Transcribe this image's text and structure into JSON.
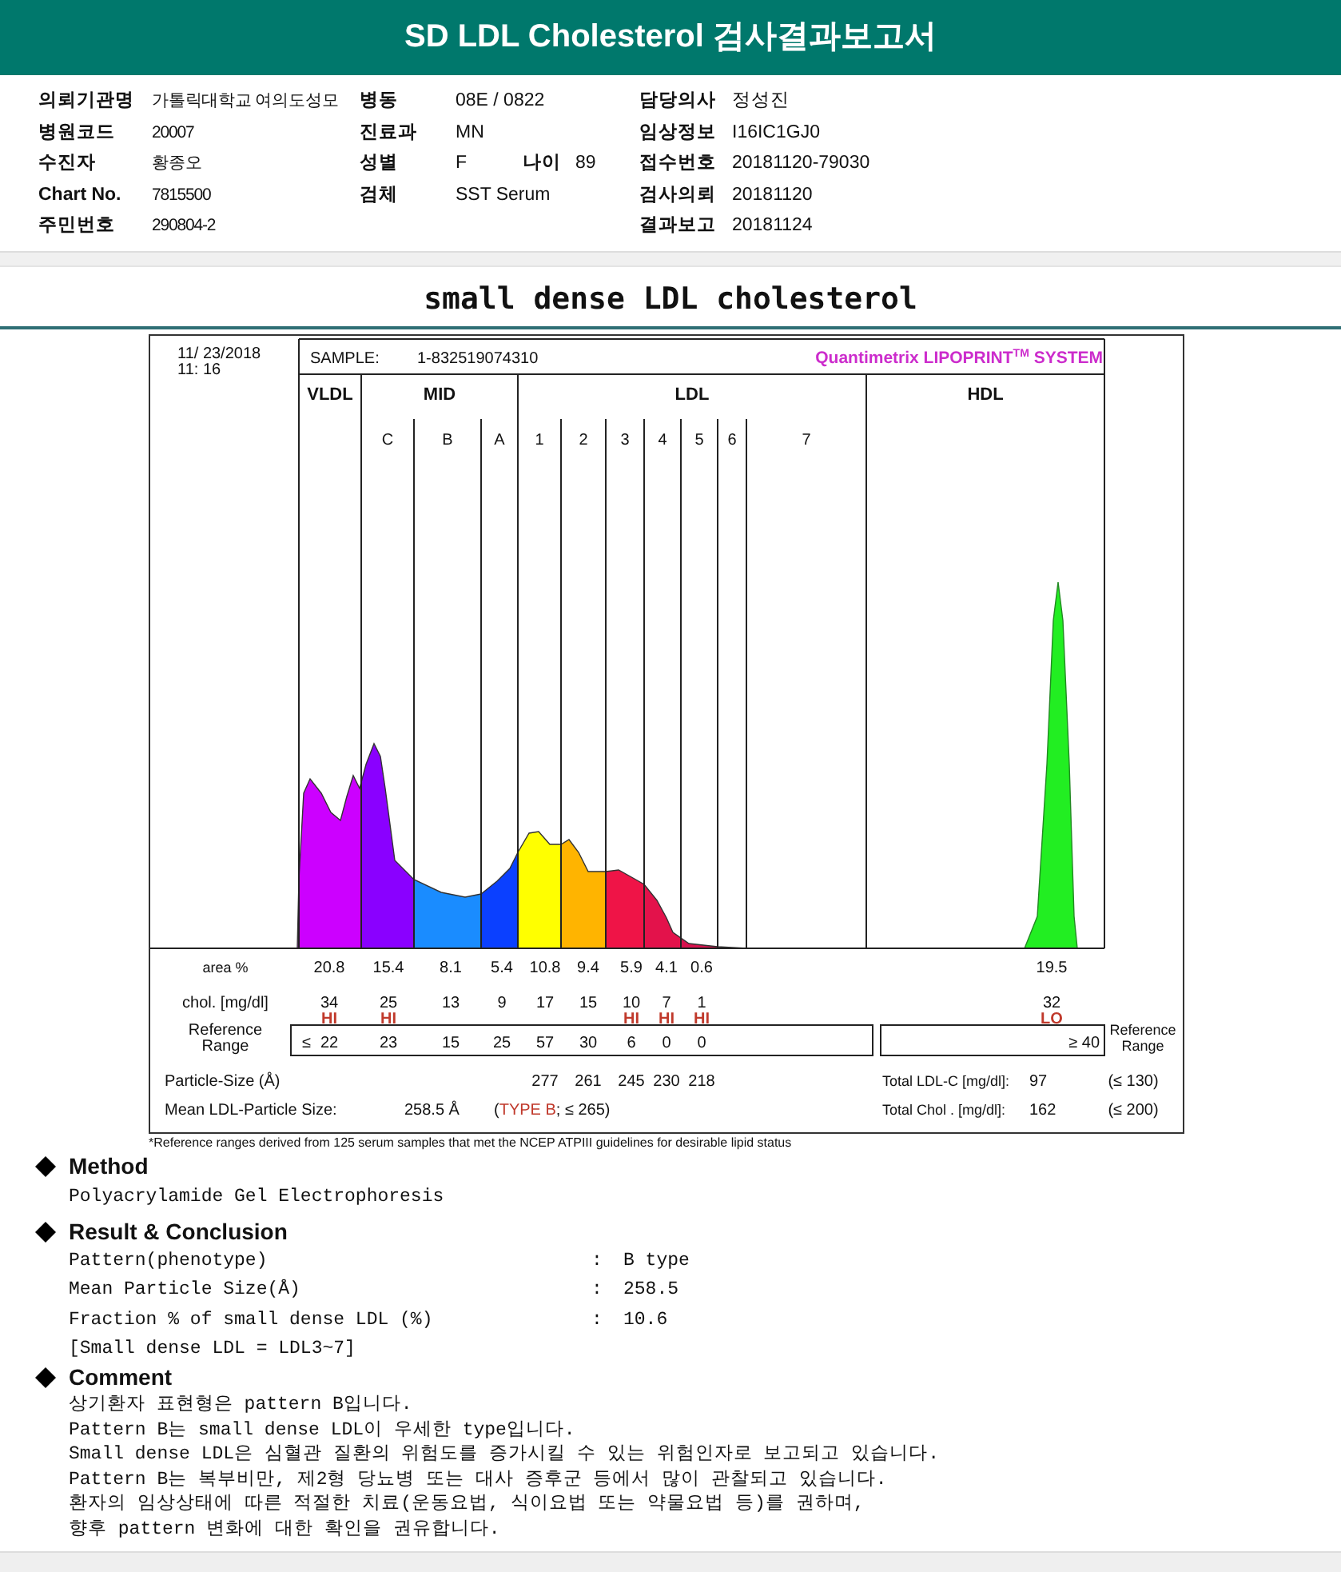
{
  "header": {
    "title": "SD LDL Cholesterol 검사결과보고서"
  },
  "info_rows": [
    {
      "left": {
        "label": "의뢰기관명",
        "value": "가톨릭대학교 여의도성모"
      },
      "middle": {
        "label": "병동",
        "value": "08E / 0822"
      },
      "right": {
        "label": "담당의사",
        "value": "정성진"
      }
    },
    {
      "left": {
        "label": "병원코드",
        "value": "20007"
      },
      "middle": {
        "label": "진료과",
        "value": "MN"
      },
      "right": {
        "label": "임상정보",
        "value": "I16IC1GJ0"
      }
    },
    {
      "left": {
        "label": "수진자",
        "value": "황종오"
      },
      "middle": {
        "label": "성별",
        "value": "F",
        "extra_label": "나이",
        "extra_value": "89"
      },
      "right": {
        "label": "접수번호",
        "value": "20181120-79030"
      }
    },
    {
      "left": {
        "label": "Chart No.",
        "value": "7815500"
      },
      "middle": {
        "label": "검체",
        "value": "SST Serum"
      },
      "right": {
        "label": "검사의뢰",
        "value": "20181120"
      }
    },
    {
      "left": {
        "label": "주민번호",
        "value": "290804-2"
      },
      "right": {
        "label": "결과보고",
        "value": "20181124"
      }
    }
  ],
  "section_title": "small dense LDL cholesterol",
  "electrophoresis": {
    "date": "11/ 23/2018",
    "time": "11: 16",
    "sample_label": "SAMPLE:",
    "sample_id": "1-832519074310",
    "system_parts": [
      {
        "text": "Quantimetrix LIPOPRINT",
        "kind": "plain"
      },
      {
        "text": "TM",
        "kind": "sup"
      },
      {
        "text": " SYSTEM",
        "kind": "plain"
      }
    ],
    "groups": [
      "VLDL",
      "MID",
      "LDL",
      "HDL"
    ],
    "subfractions": [
      "C",
      "B",
      "A",
      "1",
      "2",
      "3",
      "4",
      "5",
      "6",
      "7"
    ],
    "area_label": "area %",
    "chol_label": "chol. [mg/dl]",
    "reference_label": "Reference Range",
    "reference_label_right": "Reference Range",
    "ref_prefix": "≤",
    "columns": [
      {
        "area": "20.8",
        "chol": "34",
        "flag": "HI",
        "ref": "22"
      },
      {
        "area": "15.4",
        "chol": "25",
        "flag": "HI",
        "ref": "23"
      },
      {
        "area": "8.1",
        "chol": "13",
        "ref": "15"
      },
      {
        "area": "5.4",
        "chol": "9",
        "ref": "25"
      },
      {
        "area": "10.8",
        "chol": "17",
        "ref": "57",
        "size": "277"
      },
      {
        "area": "9.4",
        "chol": "15",
        "ref": "30",
        "size": "261"
      },
      {
        "area": "5.9",
        "chol": "10",
        "flag": "HI",
        "ref": "6",
        "size": "245"
      },
      {
        "area": "4.1",
        "chol": "7",
        "flag": "HI",
        "ref": "0",
        "size": "230"
      },
      {
        "area": "0.6",
        "chol": "1",
        "flag": "HI",
        "ref": "0",
        "size": "218"
      }
    ],
    "hdl": {
      "area": "19.5",
      "chol": "32",
      "flag": "LO",
      "ref": "≥ 40"
    },
    "particle_size_label": "Particle-Size (Å)",
    "mean_label": "Mean LDL-Particle Size:",
    "mean_value": "258.5 Å",
    "type_note_parts": [
      {
        "text": "(",
        "kind": "plain"
      },
      {
        "text": "TYPE B",
        "kind": "flag"
      },
      {
        "text": "; ≤ 265)",
        "kind": "plain"
      }
    ],
    "totals": [
      {
        "label": "Total LDL-C [mg/dl]:",
        "value": "97",
        "ref": "(≤ 130)"
      },
      {
        "label": "Total Chol . [mg/dl]:",
        "value": "162",
        "ref": "(≤ 200)"
      }
    ],
    "footnote": "*Reference ranges derived from 125 serum samples that met the NCEP ATPIII guidelines for desirable lipid status"
  },
  "method": {
    "heading": "Method",
    "text": "Polyacrylamide Gel Electrophoresis"
  },
  "result": {
    "heading": "Result & Conclusion",
    "lines": [
      {
        "label": "Pattern(phenotype)",
        "separator": ":",
        "value": "B type"
      },
      {
        "label": "Mean Particle Size(Å)",
        "separator": ":",
        "value": "258.5"
      },
      {
        "label": "Fraction % of small dense LDL (%)",
        "separator": ":",
        "value": "10.6"
      }
    ],
    "note": "[Small dense LDL = LDL3~7]"
  },
  "comment": {
    "heading": "Comment",
    "lines": [
      "상기환자 표현형은 pattern B입니다.",
      "Pattern B는 small dense LDL이 우세한 type입니다.",
      "Small dense LDL은 심혈관 질환의 위험도를 증가시킬 수 있는 위험인자로 보고되고 있습니다.",
      "Pattern B는 복부비만, 제2형 당뇨병 또는 대사 증후군 등에서 많이 관찰되고 있습니다.",
      "환자의 임상상태에 따른 적절한 치료(운동요법, 식이요법 또는 약물요법 등)를 권하며,",
      "향후 pattern 변화에 대한 확인을 권유합니다."
    ]
  }
}
